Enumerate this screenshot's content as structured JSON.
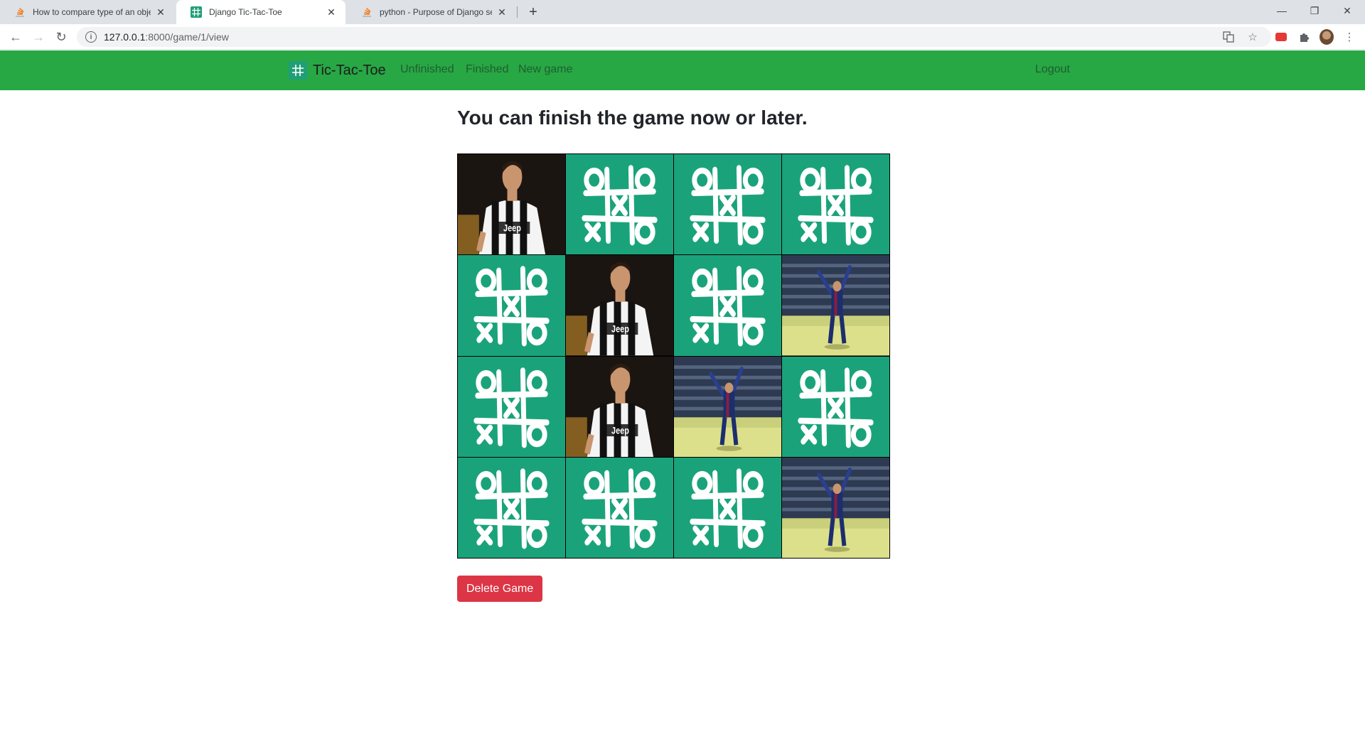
{
  "browser": {
    "tabs": [
      {
        "title": "How to compare type of an obje",
        "favicon": "stackoverflow-icon",
        "active": false
      },
      {
        "title": "Django Tic-Tac-Toe",
        "favicon": "tictactoe-icon",
        "active": true
      },
      {
        "title": "python - Purpose of Django setti",
        "favicon": "stackoverflow-icon",
        "active": false
      }
    ],
    "url_host": "127.0.0.1",
    "url_rest": ":8000/game/1/view"
  },
  "navbar": {
    "brand": "Tic-Tac-Toe",
    "links": [
      "Unfinished",
      "Finished",
      "New game"
    ],
    "logout": "Logout"
  },
  "page": {
    "heading": "You can finish the game now or later.",
    "delete_label": "Delete Game"
  },
  "board": {
    "size": 4,
    "cells": [
      "player1",
      "empty",
      "empty",
      "empty",
      "empty",
      "player1",
      "empty",
      "player2",
      "empty",
      "player1",
      "player2",
      "empty",
      "empty",
      "empty",
      "empty",
      "player2"
    ],
    "colors": {
      "empty": "#1aa37a",
      "navbar": "#28a745",
      "delete": "#dc3545"
    }
  }
}
